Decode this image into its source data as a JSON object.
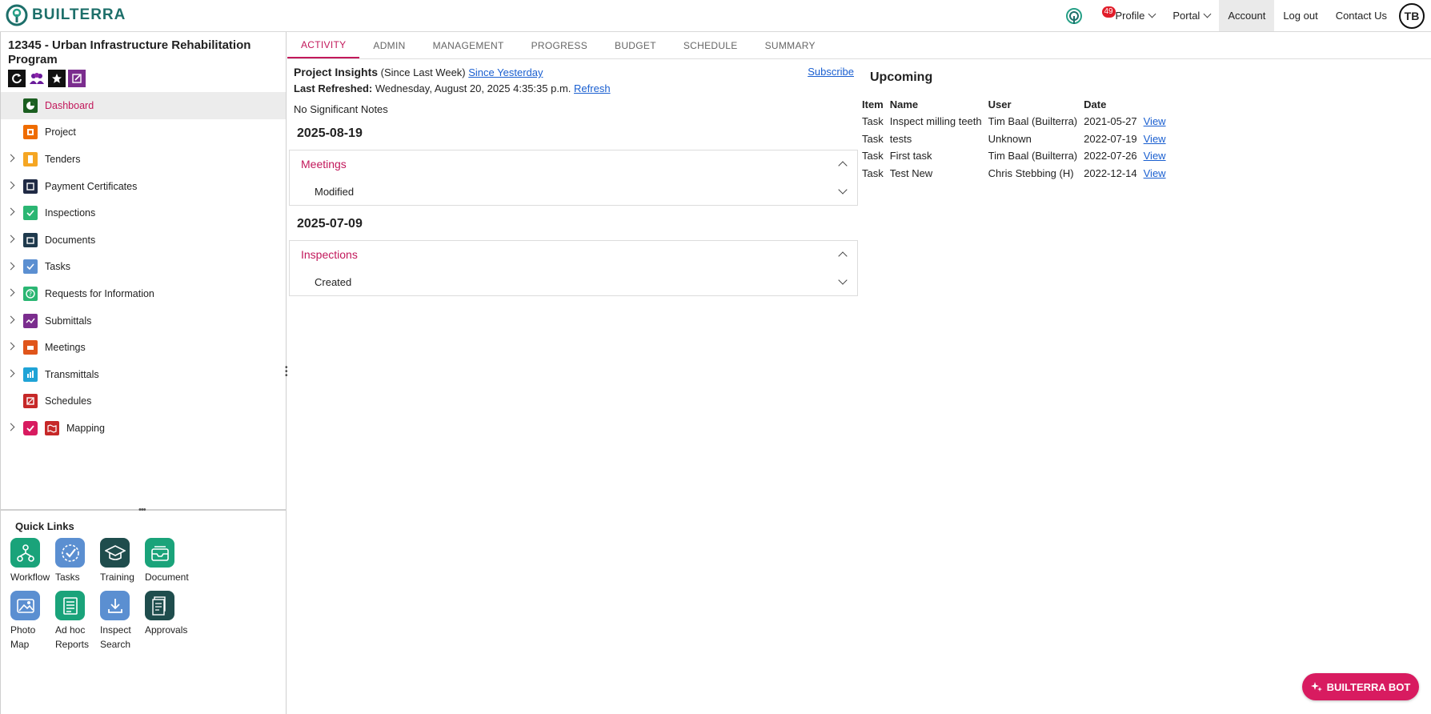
{
  "brand": {
    "name": "BUILTERRA",
    "accent": "#c2185b"
  },
  "topnav": {
    "notification_count": "49",
    "profile": "Profile",
    "portal": "Portal",
    "account": "Account",
    "logout": "Log out",
    "contact": "Contact Us",
    "avatar_initials": "TB"
  },
  "project": {
    "title": "12345 - Urban Infrastructure Rehabilitation Program"
  },
  "sidebar": {
    "items": [
      {
        "label": "Dashboard",
        "icon": "dashboard-icon",
        "color": "#2e7d32",
        "expandable": false,
        "active": true
      },
      {
        "label": "Project",
        "icon": "project-icon",
        "color": "#ef6c00",
        "expandable": false
      },
      {
        "label": "Tenders",
        "icon": "tenders-icon",
        "color": "#f5a623",
        "expandable": true
      },
      {
        "label": "Payment Certificates",
        "icon": "payment-certificates-icon",
        "color": "#1f2a44",
        "expandable": true
      },
      {
        "label": "Inspections",
        "icon": "inspections-icon",
        "color": "#2bb673",
        "expandable": true
      },
      {
        "label": "Documents",
        "icon": "documents-icon",
        "color": "#1f3a4d",
        "expandable": true
      },
      {
        "label": "Tasks",
        "icon": "tasks-icon",
        "color": "#5b8fd1",
        "expandable": true
      },
      {
        "label": "Requests for Information",
        "icon": "rfi-icon",
        "color": "#2bb673",
        "expandable": true
      },
      {
        "label": "Submittals",
        "icon": "submittals-icon",
        "color": "#7b2d8e",
        "expandable": true
      },
      {
        "label": "Meetings",
        "icon": "meetings-icon",
        "color": "#e0551b",
        "expandable": true
      },
      {
        "label": "Transmittals",
        "icon": "transmittals-icon",
        "color": "#1fa3d6",
        "expandable": true
      },
      {
        "label": "Schedules",
        "icon": "schedules-icon",
        "color": "#c62828",
        "expandable": false
      },
      {
        "label": "Mapping",
        "icon": "mapping-icon",
        "color": "#c62828",
        "expandable": true
      }
    ]
  },
  "quick_links": {
    "title": "Quick Links",
    "items": [
      {
        "label": "Workflow",
        "icon": "workflow-icon",
        "color": "#1aa37a"
      },
      {
        "label": "Tasks",
        "icon": "tasks-icon",
        "color": "#5b8fd1"
      },
      {
        "label": "Training",
        "icon": "graduation-cap-icon",
        "color": "#1f4d4d"
      },
      {
        "label": "Document",
        "icon": "document-tray-icon",
        "color": "#1aa37a"
      },
      {
        "label": "Photo Map",
        "icon": "photo-icon",
        "color": "#5b8fd1"
      },
      {
        "label": "Ad hoc Reports",
        "icon": "report-icon",
        "color": "#1aa37a"
      },
      {
        "label": "Inspect Search",
        "icon": "download-icon",
        "color": "#5b8fd1"
      },
      {
        "label": "Approvals",
        "icon": "approvals-icon",
        "color": "#1f4d4d"
      }
    ]
  },
  "tabs": [
    "ACTIVITY",
    "ADMIN",
    "MANAGEMENT",
    "PROGRESS",
    "BUDGET",
    "SCHEDULE",
    "SUMMARY"
  ],
  "insights": {
    "title": "Project Insights",
    "since_week": "(Since Last Week)",
    "since_yesterday": "Since Yesterday",
    "subscribe": "Subscribe",
    "last_refreshed_label": "Last Refreshed:",
    "last_refreshed_value": "Wednesday, August 20, 2025 4:35:35 p.m.",
    "refresh": "Refresh",
    "notes": "No Significant Notes",
    "groups": [
      {
        "date": "2025-08-19",
        "section": "Meetings",
        "change": "Modified"
      },
      {
        "date": "2025-07-09",
        "section": "Inspections",
        "change": "Created"
      }
    ]
  },
  "upcoming": {
    "title": "Upcoming",
    "columns": [
      "Item",
      "Name",
      "User",
      "Date"
    ],
    "view_label": "View",
    "rows": [
      {
        "item": "Task",
        "name": "Inspect milling teeth",
        "user": "Tim Baal (Builterra)",
        "date": "2021-05-27"
      },
      {
        "item": "Task",
        "name": "tests",
        "user": "Unknown",
        "date": "2022-07-19"
      },
      {
        "item": "Task",
        "name": "First task",
        "user": "Tim Baal (Builterra)",
        "date": "2022-07-26"
      },
      {
        "item": "Task",
        "name": "Test New",
        "user": "Chris Stebbing (H)",
        "date": "2022-12-14"
      }
    ]
  },
  "bot": {
    "label": "BUILTERRA BOT"
  }
}
